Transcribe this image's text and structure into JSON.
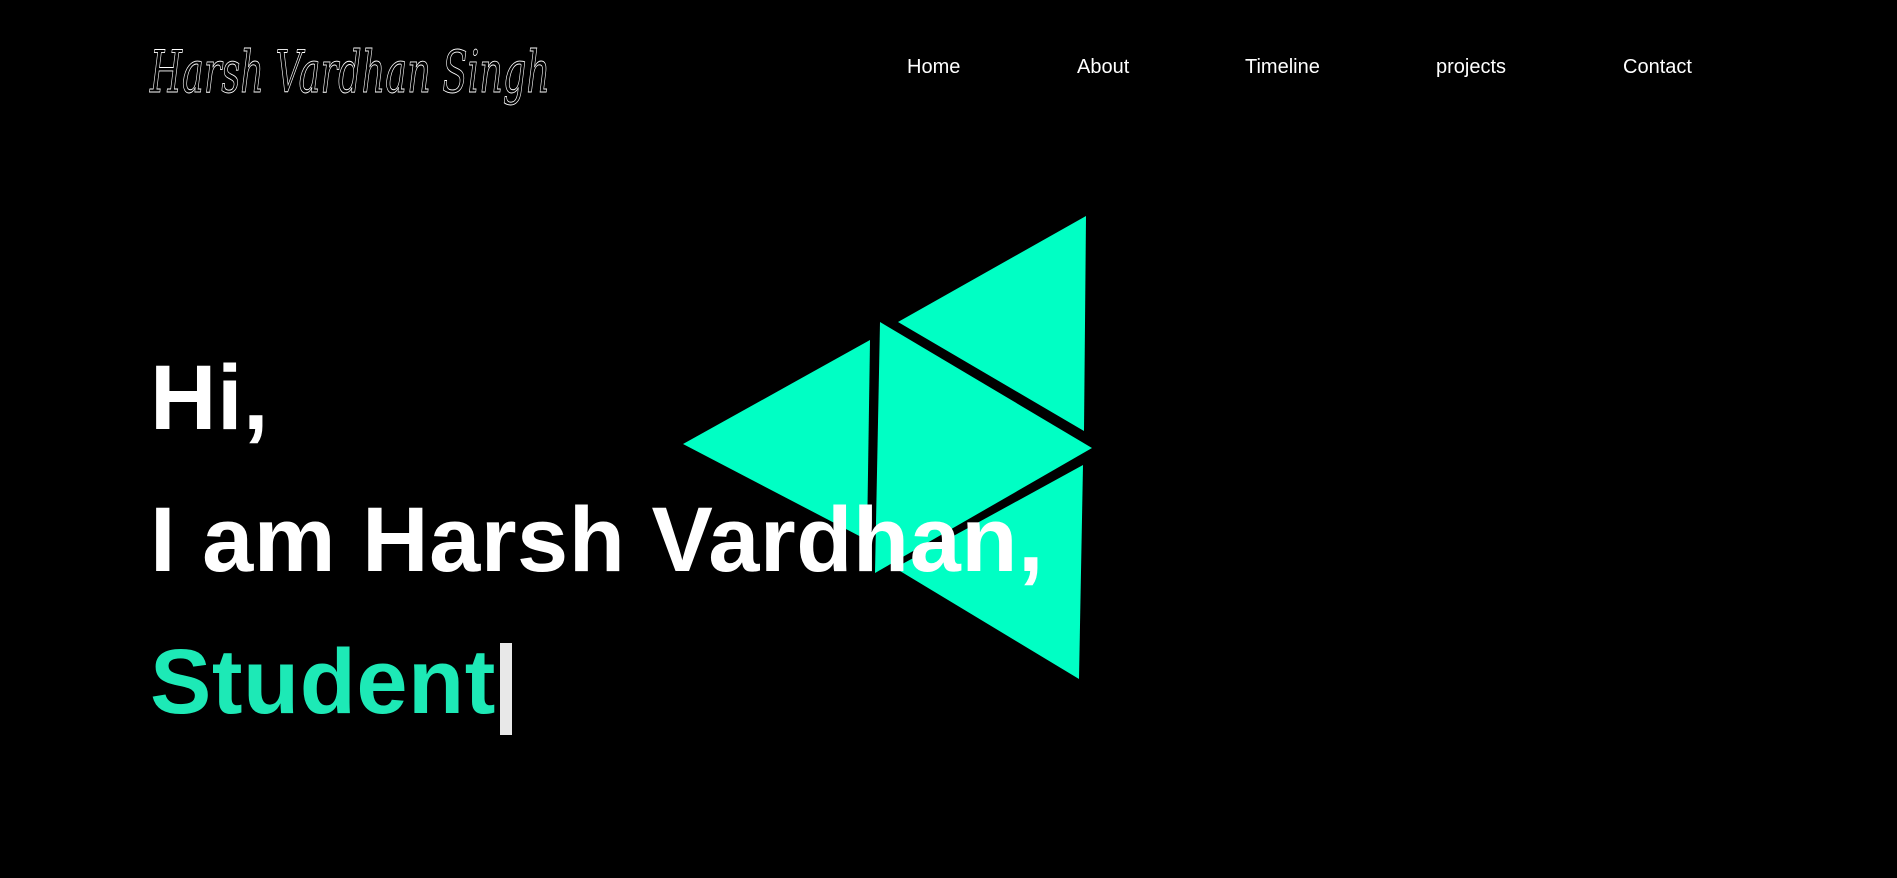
{
  "header": {
    "logo_text": "Harsh Vardhan Singh",
    "nav": [
      {
        "label": "Home"
      },
      {
        "label": "About"
      },
      {
        "label": "Timeline"
      },
      {
        "label": "projects"
      },
      {
        "label": "Contact"
      }
    ]
  },
  "hero": {
    "greeting": "Hi,",
    "intro": "I am Harsh Vardhan,",
    "role": "Student"
  },
  "colors": {
    "background": "#000000",
    "accent": "#00ffc4",
    "role_text": "#1de9b6",
    "text": "#ffffff"
  }
}
